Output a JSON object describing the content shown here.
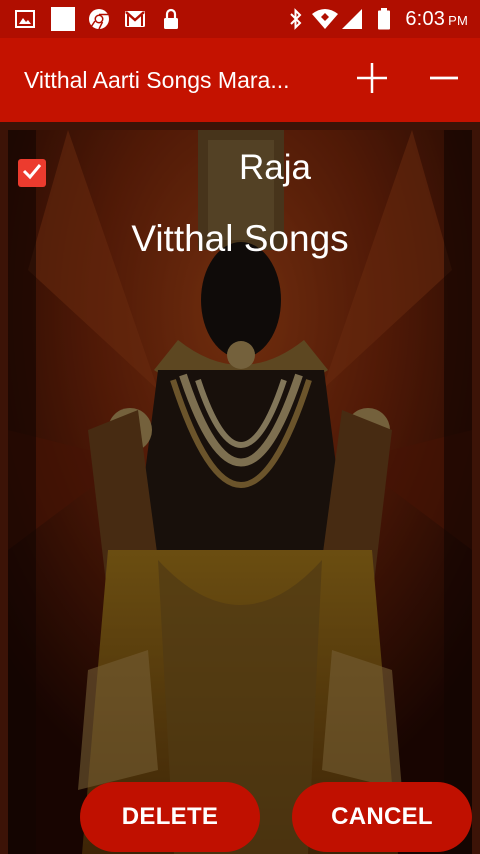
{
  "status_bar": {
    "time": "6:03",
    "ampm": "PM",
    "icons": [
      "image-icon",
      "white-square-icon",
      "chrome-icon",
      "gmail-icon",
      "lock-icon",
      "bluetooth-icon",
      "wifi-icon",
      "signal-icon",
      "battery-icon"
    ]
  },
  "app_bar": {
    "title": "Vitthal Aarti Songs Mara...",
    "actions": [
      "plus-icon",
      "minus-icon"
    ]
  },
  "item": {
    "checked": true,
    "title": "Raja",
    "subtitle": "Vitthal Songs"
  },
  "buttons": {
    "delete": "DELETE",
    "cancel": "CANCEL"
  },
  "colors": {
    "status_bar": "#b00e00",
    "app_bar": "#c41200",
    "button": "#c01000",
    "checkbox": "#ec3b2e"
  }
}
